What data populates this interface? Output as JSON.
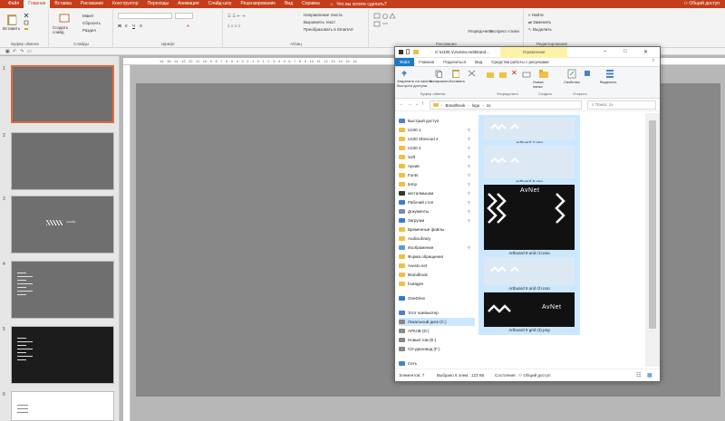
{
  "menu": {
    "tabs": [
      "Файл",
      "Главная",
      "Вставка",
      "Рисование",
      "Конструктор",
      "Переходы",
      "Анимация",
      "Слайд-шоу",
      "Рецензирование",
      "Вид",
      "Справка"
    ],
    "active_index": 1,
    "tell_me": "Что вы хотите сделать?",
    "share": "Общий доступ"
  },
  "ribbon": {
    "paste": "Вставить",
    "clipboard_group": "Буфер обмена",
    "new_slide": "Создать слайд",
    "layout": "Макет",
    "reset": "Сбросить",
    "section": "Раздел",
    "slides_group": "Слайды",
    "font_group": "Шрифт",
    "paragraph_group": "Абзац",
    "text_direction": "Направление текста",
    "align_text": "Выровнять текст",
    "convert_smartart": "Преобразовать в SmartArt",
    "drawing_group": "Рисование",
    "arrange": "Упорядочить",
    "quick_styles": "Экспресс-стили",
    "find": "Найти",
    "replace": "Заменить",
    "select": "Выделить",
    "editing_group": "Редактирование"
  },
  "slides": [
    {
      "num": "1",
      "style": "gray-selected"
    },
    {
      "num": "2",
      "style": "gray"
    },
    {
      "num": "3",
      "style": "gray-logo",
      "logo_text": "СЛАЙД"
    },
    {
      "num": "4",
      "style": "gray-text"
    },
    {
      "num": "5",
      "style": "black-text"
    },
    {
      "num": "6",
      "style": "white"
    }
  ],
  "ruler_ticks": "16 · 15 · 14 · 13 · 12 · 11 · 10 · 9 · 8 · 7 · 6 · 5 · 4 · 3 · 2 · 1 · 0 · 1 · 2 · 3 · 4 · 5 · 6 · 7 · 8 · 9 · 10 · 11 · 12 · 13 · 14 · 15 · 16",
  "explorer": {
    "title": "C:\\U100 1\\Avesto.net\\Brand...",
    "manage_tab": "Управление",
    "tabs": [
      "Файл",
      "Главная",
      "Поделиться",
      "Вид",
      "Средства работы с рисунками"
    ],
    "ribbon": {
      "pin": "Закрепить на панели быстрого доступа",
      "copy": "Копировать",
      "paste": "Вставить",
      "clipboard": "Буфер обмена",
      "organize": "Упорядочить",
      "new_folder": "Новая папка",
      "create": "Создать",
      "properties": "Свойства",
      "open": "Открыть",
      "select": "Выделить"
    },
    "breadcrumb": [
      "Brandbook",
      "logo",
      "1x"
    ],
    "search_placeholder": "Поиск: 1x",
    "nav": [
      {
        "label": "Быстрый доступ",
        "icon": "star",
        "pin": false
      },
      {
        "label": "U100 1",
        "icon": "folder",
        "pin": true
      },
      {
        "label": "U100 Shevood 2",
        "icon": "folder",
        "pin": true
      },
      {
        "label": "U100 4",
        "icon": "folder",
        "pin": true
      },
      {
        "label": "Soft",
        "icon": "folder",
        "pin": true
      },
      {
        "label": "Архив",
        "icon": "folder",
        "pin": true
      },
      {
        "label": "Fonts",
        "icon": "folder",
        "pin": true
      },
      {
        "label": "temp",
        "icon": "folder",
        "pin": true
      },
      {
        "label": "кисталмышки",
        "icon": "dark",
        "pin": true
      },
      {
        "label": "Рабочий стол",
        "icon": "desktop",
        "pin": true
      },
      {
        "label": "Документы",
        "icon": "docs",
        "pin": true
      },
      {
        "label": "Загрузки",
        "icon": "download",
        "pin": true
      },
      {
        "label": "Временные файлы",
        "icon": "folder",
        "pin": false
      },
      {
        "label": "AudioLibrary",
        "icon": "folder",
        "pin": false
      },
      {
        "label": "Изображения",
        "icon": "images",
        "pin": true
      },
      {
        "label": "Форма обращения",
        "icon": "folder",
        "pin": false
      },
      {
        "label": "Avesto.net",
        "icon": "folder",
        "pin": false
      },
      {
        "label": "Brandbook",
        "icon": "folder",
        "pin": false
      },
      {
        "label": "footages",
        "icon": "folder",
        "pin": false
      },
      {
        "label": "OneDrive",
        "icon": "cloud",
        "pin": false
      },
      {
        "label": "Этот компьютер",
        "icon": "pc",
        "pin": false
      },
      {
        "label": "Локальный диск (C:)",
        "icon": "drive",
        "pin": false,
        "selected": true
      },
      {
        "label": "APIUIB (D:)",
        "icon": "drive",
        "pin": false
      },
      {
        "label": "Новый том (E:)",
        "icon": "drive",
        "pin": false
      },
      {
        "label": "CD-дисковод (F:)",
        "icon": "cd",
        "pin": false
      },
      {
        "label": "Сеть",
        "icon": "network",
        "pin": false
      }
    ],
    "files": [
      {
        "name": "Artboard 7.png",
        "kind": "white-zigzag"
      },
      {
        "name": "Artboard 8.png",
        "kind": "white-zigzag"
      },
      {
        "name": "Artboard 9 grid (1).png",
        "kind": "black-grid",
        "brand": "AvNet"
      },
      {
        "name": "Artboard 9 grid (2).png",
        "kind": "white-zigzag"
      },
      {
        "name": "Artboard 9 grid (3).png",
        "kind": "black-brand",
        "brand": "AvNet"
      }
    ],
    "status": {
      "count": "Элементов: 7",
      "selected": "Выбрано 5 элем.: 123 КБ",
      "state": "Состояние:",
      "shared": "Общий доступ"
    }
  },
  "colors": {
    "accent": "#c43e1c",
    "explorer_file_tab": "#1979ca",
    "selection": "#cce8ff",
    "folder": "#f0c040",
    "manage_tab": "#fff2a8"
  }
}
